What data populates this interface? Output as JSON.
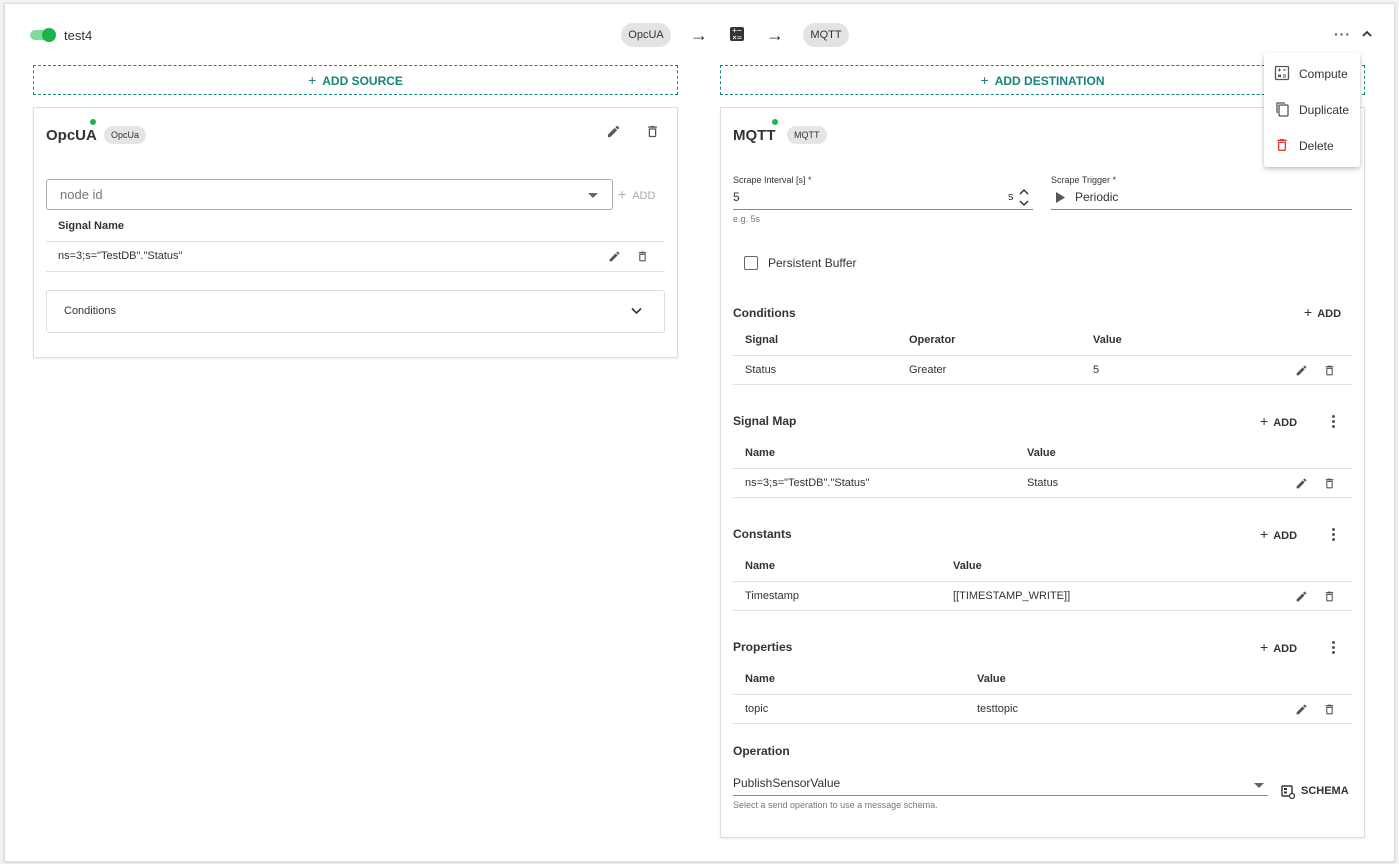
{
  "header": {
    "flow_name": "test4",
    "enabled": true,
    "source_chip": "OpcUA",
    "dest_chip": "MQTT",
    "more_icon": "more-horizontal-icon",
    "collapse_icon": "chevron-up-icon"
  },
  "source": {
    "add_label": "ADD SOURCE",
    "title": "OpcUA",
    "type_chip": "OpcUa",
    "status_color": "#1bb34a",
    "node_placeholder": "node id",
    "add_label_small": "ADD",
    "table": {
      "header": "Signal Name",
      "rows": [
        {
          "name": "ns=3;s=\"TestDB\".\"Status\""
        }
      ]
    },
    "conditions_label": "Conditions"
  },
  "destination": {
    "add_label": "ADD DESTINATION",
    "title": "MQTT",
    "type_chip": "MQTT",
    "status_color": "#1bb34a",
    "scrape_interval": {
      "label": "Scrape Interval [s] *",
      "value": "5",
      "unit": "s",
      "helper": "e.g. 5s"
    },
    "scrape_trigger": {
      "label": "Scrape Trigger *",
      "value": "Periodic"
    },
    "persistent_buffer": {
      "label": "Persistent Buffer",
      "checked": false
    },
    "conditions": {
      "title": "Conditions",
      "add_label": "ADD",
      "headers": [
        "Signal",
        "Operator",
        "Value"
      ],
      "rows": [
        {
          "signal": "Status",
          "operator": "Greater",
          "value": "5"
        }
      ]
    },
    "signal_map": {
      "title": "Signal Map",
      "add_label": "ADD",
      "headers": [
        "Name",
        "Value"
      ],
      "rows": [
        {
          "name": "ns=3;s=\"TestDB\".\"Status\"",
          "value": "Status"
        }
      ]
    },
    "constants": {
      "title": "Constants",
      "add_label": "ADD",
      "headers": [
        "Name",
        "Value"
      ],
      "rows": [
        {
          "name": "Timestamp",
          "value": "[[TIMESTAMP_WRITE]]"
        }
      ]
    },
    "properties": {
      "title": "Properties",
      "add_label": "ADD",
      "headers": [
        "Name",
        "Value"
      ],
      "rows": [
        {
          "name": "topic",
          "value": "testtopic"
        }
      ]
    },
    "operation": {
      "title": "Operation",
      "value": "PublishSensorValue",
      "helper": "Select a send operation to use a message schema.",
      "schema_label": "SCHEMA"
    }
  },
  "menu": {
    "items": [
      {
        "label": "Compute",
        "icon": "calculator-icon"
      },
      {
        "label": "Duplicate",
        "icon": "copy-icon"
      },
      {
        "label": "Delete",
        "icon": "delete-icon"
      }
    ]
  },
  "colors": {
    "accent": "#17857a",
    "toggle_on": "#1bb34a",
    "delete": "#e53935"
  }
}
